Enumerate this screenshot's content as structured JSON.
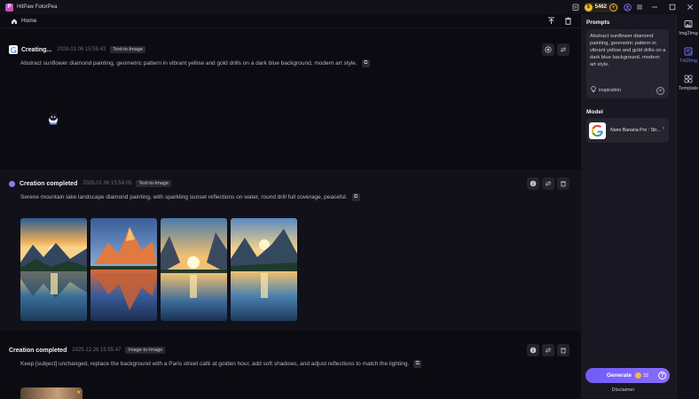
{
  "app": {
    "title": "HitPaw FotorPea",
    "credits": "5462"
  },
  "nav": {
    "home_label": "Home"
  },
  "feed": {
    "cards": [
      {
        "status": "Creating...",
        "time": "2026.01.06 15:55:43",
        "badge": "Text-to-Image",
        "prompt": "Abstract sunflower diamond painting, geometric pattern in vibrant yellow and gold drills on a dark blue background, modern art style."
      },
      {
        "status": "Creation completed",
        "time": "2026.01.06 15:54:05",
        "badge": "Text-to-Image",
        "prompt": "Serene mountain lake landscape diamond painting, with sparkling sunset reflections on water, round drill full coverage, peaceful."
      },
      {
        "status": "Creation completed",
        "time": "2025.12.26 15:55:47",
        "badge": "Image-to-Image",
        "prompt": "Keep [subject] unchanged, replace the background with a Paris street café at golden hour, add soft shadows, and adjust reflections to match the lighting."
      }
    ]
  },
  "panel": {
    "prompts_heading": "Prompts",
    "prompt_text": "Abstract sunflower diamond painting, geometric pattern in vibrant yellow and gold drills on a dark blue background, modern art style.",
    "inspiration_label": "inspiration",
    "model_heading": "Model",
    "model_name": "Nano Banana Pro : Str...",
    "generate_label": "Generate",
    "generate_cost": "32",
    "disclaimer": "Disclaimer"
  },
  "rail": {
    "items": [
      {
        "label": "Img2Img",
        "icon": "image-icon"
      },
      {
        "label": "Txt2Img",
        "icon": "text-image-icon"
      },
      {
        "label": "Template",
        "icon": "template-grid-icon"
      }
    ]
  },
  "colors": {
    "accent": "#7c6cf8",
    "coin": "#f5b83a",
    "background": "#0c0b12",
    "panel": "#191822"
  }
}
